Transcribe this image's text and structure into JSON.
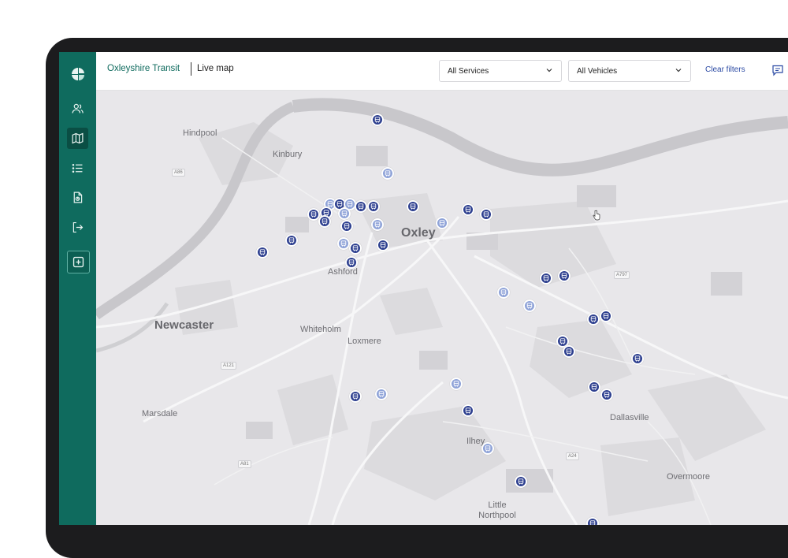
{
  "app": {
    "brand": "Oxleyshire Transit",
    "page_title": "Live map"
  },
  "filters": {
    "services": "All Services",
    "vehicles": "All Vehicles",
    "clear_label": "Clear filters"
  },
  "sidebar": {
    "items": [
      {
        "name": "logo",
        "icon": "logo-icon"
      },
      {
        "name": "users",
        "icon": "users-icon"
      },
      {
        "name": "map",
        "icon": "map-icon",
        "active": true
      },
      {
        "name": "list",
        "icon": "list-icon"
      },
      {
        "name": "report",
        "icon": "document-icon"
      },
      {
        "name": "logout",
        "icon": "logout-icon"
      },
      {
        "name": "add",
        "icon": "add-icon"
      }
    ]
  },
  "map": {
    "places": [
      "Hindpool",
      "Kinbury",
      "Oxley",
      "Ashford",
      "Newcaster",
      "Whiteholm",
      "Loxmere",
      "Marsdale",
      "Ilhey",
      "Dallasville",
      "Overmoore",
      "Little Northpool"
    ],
    "roads": [
      "A86",
      "A797",
      "A121",
      "A81",
      "A24"
    ]
  },
  "colors": {
    "sidebar": "#0f6b5e",
    "bus_active": "#2d3f8f",
    "bus_faded": "#8fa3d8",
    "accent_link": "#2a49a3"
  }
}
